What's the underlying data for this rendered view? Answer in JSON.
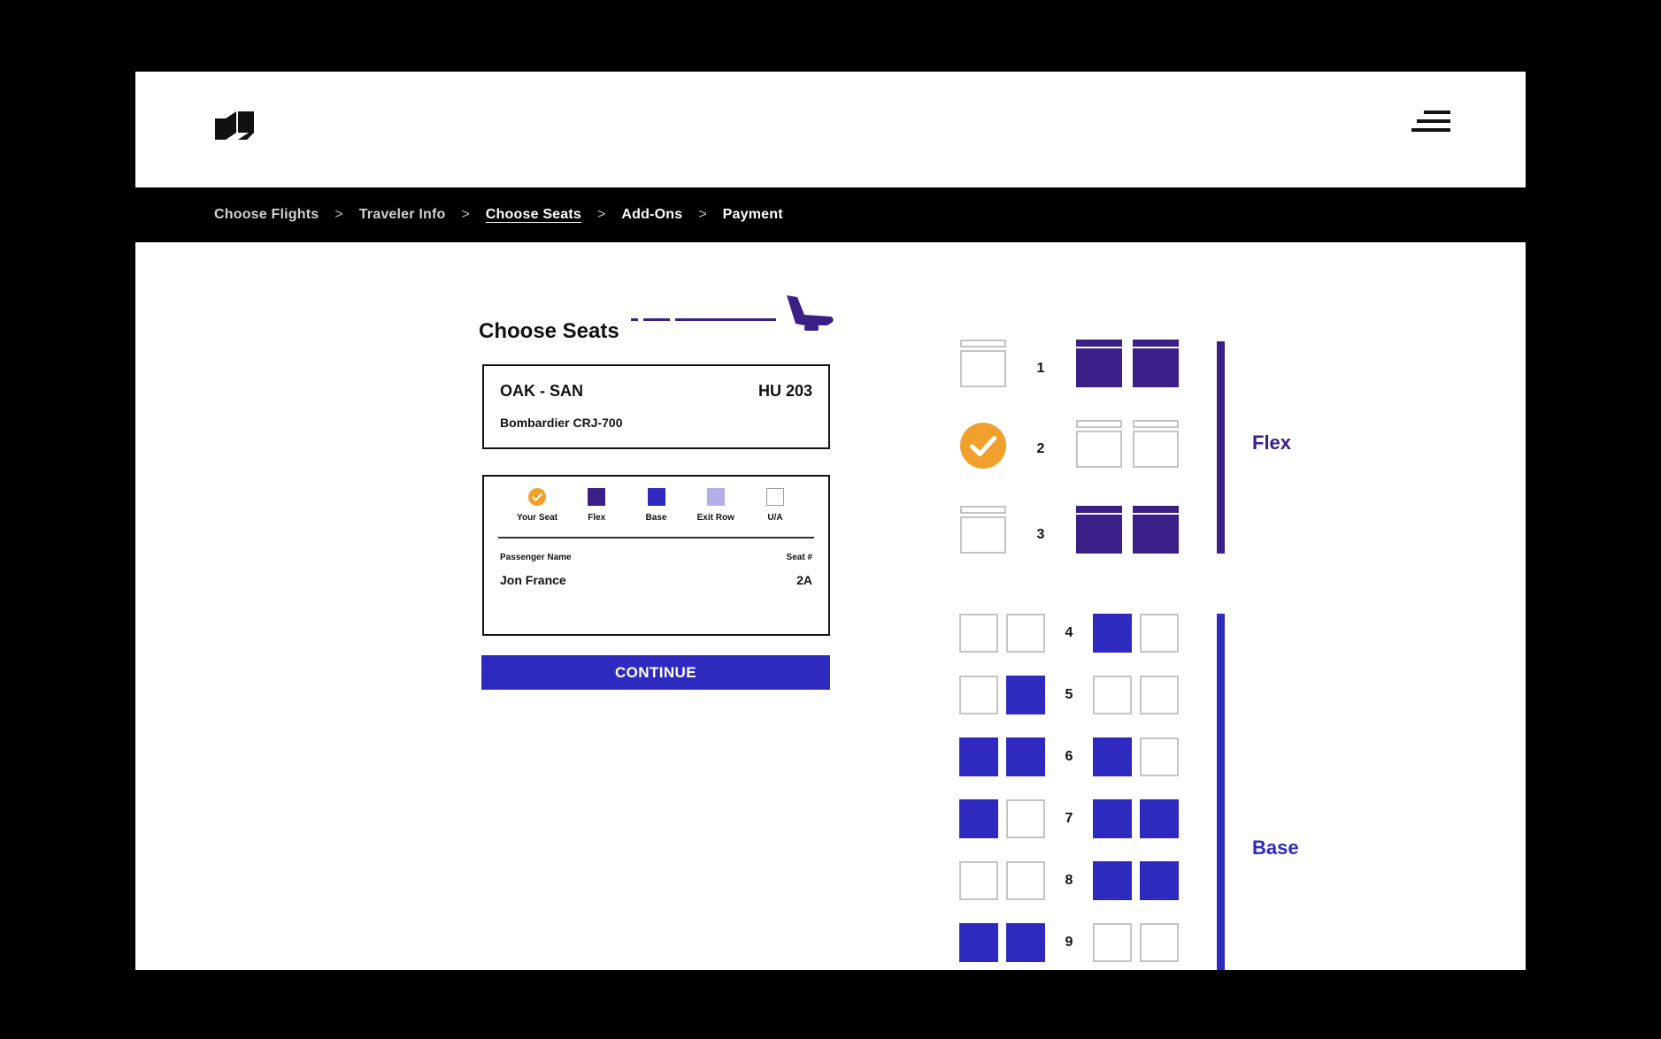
{
  "colors": {
    "flex": "#3b1f87",
    "base": "#2f2abf",
    "exit_row": "#b3aee8",
    "selected": "#f0a02b",
    "seat_outline": "#9a9a9a"
  },
  "header": {
    "logo_icon": "brand-logo-icon",
    "menu_icon": "hamburger-menu-icon"
  },
  "breadcrumb": {
    "items": [
      {
        "label": "Choose Flights",
        "state": "done"
      },
      {
        "label": "Traveler Info",
        "state": "done"
      },
      {
        "label": "Choose Seats",
        "state": "current"
      },
      {
        "label": "Add-Ons",
        "state": "upcoming"
      },
      {
        "label": "Payment",
        "state": "upcoming"
      }
    ],
    "separator": ">"
  },
  "page": {
    "title": "Choose Seats",
    "title_icon": "airplane-seat-icon"
  },
  "flight": {
    "route": "OAK - SAN",
    "flight_number": "HU 203",
    "aircraft": "Bombardier CRJ-700"
  },
  "legend": {
    "items": [
      {
        "label": "Your Seat",
        "type": "selected"
      },
      {
        "label": "Flex",
        "type": "flex"
      },
      {
        "label": "Base",
        "type": "base"
      },
      {
        "label": "Exit Row",
        "type": "exit_row"
      },
      {
        "label": "U/A",
        "type": "unavailable"
      }
    ]
  },
  "passenger": {
    "name_header": "Passenger Name",
    "seat_header": "Seat #",
    "name": "Jon France",
    "seat": "2A"
  },
  "continue_label": "CONTINUE",
  "seat_map": {
    "flex": {
      "label": "Flex",
      "rows": [
        {
          "row": "1",
          "seats": [
            "unavailable",
            "flex",
            "flex"
          ]
        },
        {
          "row": "2",
          "seats": [
            "selected",
            "unavailable",
            "unavailable"
          ]
        },
        {
          "row": "3",
          "seats": [
            "unavailable",
            "flex",
            "flex"
          ]
        }
      ]
    },
    "base": {
      "label": "Base",
      "rows": [
        {
          "row": "4",
          "seats": [
            "unavailable",
            "unavailable",
            "base",
            "unavailable"
          ]
        },
        {
          "row": "5",
          "seats": [
            "unavailable",
            "base",
            "unavailable",
            "unavailable"
          ]
        },
        {
          "row": "6",
          "seats": [
            "base",
            "base",
            "base",
            "unavailable"
          ]
        },
        {
          "row": "7",
          "seats": [
            "base",
            "unavailable",
            "base",
            "base"
          ]
        },
        {
          "row": "8",
          "seats": [
            "unavailable",
            "unavailable",
            "base",
            "base"
          ]
        },
        {
          "row": "9",
          "seats": [
            "base",
            "base",
            "unavailable",
            "unavailable"
          ]
        }
      ]
    }
  }
}
